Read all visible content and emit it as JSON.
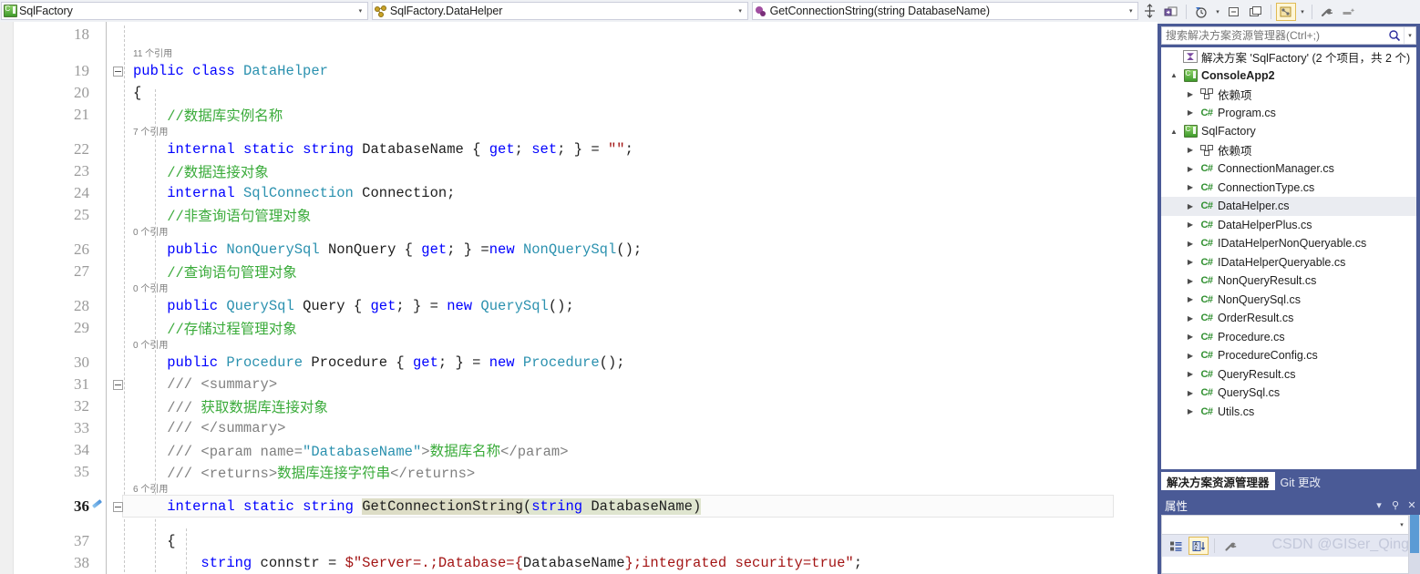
{
  "navbar": {
    "project_combo": {
      "icon": "csharp-project-icon",
      "value": "SqlFactory",
      "arrow": "▾"
    },
    "type_combo": {
      "icon": "class-icon",
      "value": "SqlFactory.DataHelper",
      "arrow": "▾"
    },
    "member_combo": {
      "icon": "method-icon",
      "value": "GetConnectionString(string DatabaseName)",
      "arrow": "▾"
    },
    "splitter_icon": "split-window-icon"
  },
  "editor": {
    "lines": [
      {
        "num": "18",
        "fold": false,
        "ref": null,
        "tokens": []
      },
      {
        "num": "19",
        "fold": true,
        "ref": "11 个引用",
        "tokens": [
          {
            "t": "public ",
            "c": "tok-kw"
          },
          {
            "t": "class ",
            "c": "tok-kw"
          },
          {
            "t": "DataHelper",
            "c": "tok-type"
          }
        ]
      },
      {
        "num": "20",
        "fold": false,
        "ref": null,
        "tokens": [
          {
            "t": "{",
            "c": "tok-plain"
          }
        ]
      },
      {
        "num": "21",
        "fold": false,
        "ref": null,
        "tokens": [
          {
            "t": "    //数据库实例名称",
            "c": "tok-cmt"
          }
        ]
      },
      {
        "num": "22",
        "fold": false,
        "ref": "7 个引用",
        "tokens": [
          {
            "t": "    ",
            "c": "tok-plain"
          },
          {
            "t": "internal ",
            "c": "tok-kw"
          },
          {
            "t": "static ",
            "c": "tok-kw"
          },
          {
            "t": "string ",
            "c": "tok-kw"
          },
          {
            "t": "DatabaseName { ",
            "c": "tok-plain"
          },
          {
            "t": "get",
            "c": "tok-kw"
          },
          {
            "t": "; ",
            "c": "tok-plain"
          },
          {
            "t": "set",
            "c": "tok-kw"
          },
          {
            "t": "; } = ",
            "c": "tok-plain"
          },
          {
            "t": "\"\"",
            "c": "tok-str"
          },
          {
            "t": ";",
            "c": "tok-plain"
          }
        ]
      },
      {
        "num": "23",
        "fold": false,
        "ref": null,
        "tokens": [
          {
            "t": "    //数据连接对象",
            "c": "tok-cmt"
          }
        ]
      },
      {
        "num": "24",
        "fold": false,
        "ref": null,
        "tokens": [
          {
            "t": "    ",
            "c": "tok-plain"
          },
          {
            "t": "internal ",
            "c": "tok-kw"
          },
          {
            "t": "SqlConnection",
            "c": "tok-type"
          },
          {
            "t": " Connection;",
            "c": "tok-plain"
          }
        ]
      },
      {
        "num": "25",
        "fold": false,
        "ref": null,
        "tokens": [
          {
            "t": "    //非查询语句管理对象",
            "c": "tok-cmt"
          }
        ]
      },
      {
        "num": "26",
        "fold": false,
        "ref": "0 个引用",
        "tokens": [
          {
            "t": "    ",
            "c": "tok-plain"
          },
          {
            "t": "public ",
            "c": "tok-kw"
          },
          {
            "t": "NonQuerySql",
            "c": "tok-type"
          },
          {
            "t": " NonQuery { ",
            "c": "tok-plain"
          },
          {
            "t": "get",
            "c": "tok-kw"
          },
          {
            "t": "; } =",
            "c": "tok-plain"
          },
          {
            "t": "new ",
            "c": "tok-kw"
          },
          {
            "t": "NonQuerySql",
            "c": "tok-type"
          },
          {
            "t": "();",
            "c": "tok-plain"
          }
        ]
      },
      {
        "num": "27",
        "fold": false,
        "ref": null,
        "tokens": [
          {
            "t": "    //查询语句管理对象",
            "c": "tok-cmt"
          }
        ]
      },
      {
        "num": "28",
        "fold": false,
        "ref": "0 个引用",
        "tokens": [
          {
            "t": "    ",
            "c": "tok-plain"
          },
          {
            "t": "public ",
            "c": "tok-kw"
          },
          {
            "t": "QuerySql",
            "c": "tok-type"
          },
          {
            "t": " Query { ",
            "c": "tok-plain"
          },
          {
            "t": "get",
            "c": "tok-kw"
          },
          {
            "t": "; } = ",
            "c": "tok-plain"
          },
          {
            "t": "new ",
            "c": "tok-kw"
          },
          {
            "t": "QuerySql",
            "c": "tok-type"
          },
          {
            "t": "();",
            "c": "tok-plain"
          }
        ]
      },
      {
        "num": "29",
        "fold": false,
        "ref": null,
        "tokens": [
          {
            "t": "    //存储过程管理对象",
            "c": "tok-cmt"
          }
        ]
      },
      {
        "num": "30",
        "fold": false,
        "ref": "0 个引用",
        "tokens": [
          {
            "t": "    ",
            "c": "tok-plain"
          },
          {
            "t": "public ",
            "c": "tok-kw"
          },
          {
            "t": "Procedure",
            "c": "tok-type"
          },
          {
            "t": " Procedure { ",
            "c": "tok-plain"
          },
          {
            "t": "get",
            "c": "tok-kw"
          },
          {
            "t": "; } = ",
            "c": "tok-plain"
          },
          {
            "t": "new ",
            "c": "tok-kw"
          },
          {
            "t": "Procedure",
            "c": "tok-type"
          },
          {
            "t": "();",
            "c": "tok-plain"
          }
        ]
      },
      {
        "num": "31",
        "fold": true,
        "ref": null,
        "tokens": [
          {
            "t": "    /// ",
            "c": "tok-cmt-x"
          },
          {
            "t": "<summary>",
            "c": "tok-xml"
          }
        ]
      },
      {
        "num": "32",
        "fold": false,
        "ref": null,
        "tokens": [
          {
            "t": "    /// ",
            "c": "tok-cmt-x"
          },
          {
            "t": "获取数据库连接对象",
            "c": "tok-xmltxt"
          }
        ]
      },
      {
        "num": "33",
        "fold": false,
        "ref": null,
        "tokens": [
          {
            "t": "    /// ",
            "c": "tok-cmt-x"
          },
          {
            "t": "</summary>",
            "c": "tok-xml"
          }
        ]
      },
      {
        "num": "34",
        "fold": false,
        "ref": null,
        "tokens": [
          {
            "t": "    /// ",
            "c": "tok-cmt-x"
          },
          {
            "t": "<param name=",
            "c": "tok-xml"
          },
          {
            "t": "\"DatabaseName\"",
            "c": "tok-type"
          },
          {
            "t": ">",
            "c": "tok-xml"
          },
          {
            "t": "数据库名称",
            "c": "tok-xmltxt"
          },
          {
            "t": "</param>",
            "c": "tok-xml"
          }
        ]
      },
      {
        "num": "35",
        "fold": false,
        "ref": null,
        "tokens": [
          {
            "t": "    /// ",
            "c": "tok-cmt-x"
          },
          {
            "t": "<returns>",
            "c": "tok-xml"
          },
          {
            "t": "数据库连接字符串",
            "c": "tok-xmltxt"
          },
          {
            "t": "</returns>",
            "c": "tok-xml"
          }
        ]
      },
      {
        "num": "36",
        "fold": true,
        "ref": "6 个引用",
        "current": true,
        "edited": true,
        "tokens": [
          {
            "t": "    ",
            "c": "tok-plain"
          },
          {
            "t": "internal ",
            "c": "tok-kw"
          },
          {
            "t": "static ",
            "c": "tok-kw"
          },
          {
            "t": "string ",
            "c": "tok-kw"
          },
          {
            "t": "GetConnectionString",
            "c": "tok-plain hl-method"
          },
          {
            "t": "(",
            "c": "tok-plain hl-param"
          },
          {
            "t": "string ",
            "c": "tok-kw hl-param"
          },
          {
            "t": "DatabaseName",
            "c": "tok-plain hl-param"
          },
          {
            "t": ")",
            "c": "tok-plain hl-param"
          }
        ]
      },
      {
        "num": "37",
        "fold": false,
        "ref": null,
        "tokens": [
          {
            "t": "    {",
            "c": "tok-plain"
          }
        ]
      },
      {
        "num": "38",
        "fold": false,
        "ref": null,
        "tokens": [
          {
            "t": "        ",
            "c": "tok-plain"
          },
          {
            "t": "string ",
            "c": "tok-kw"
          },
          {
            "t": "connstr = ",
            "c": "tok-plain"
          },
          {
            "t": "$\"Server=.;Database={",
            "c": "tok-str"
          },
          {
            "t": "DatabaseName",
            "c": "tok-plain"
          },
          {
            "t": "};integrated security=true\"",
            "c": "tok-str"
          },
          {
            "t": ";",
            "c": "tok-plain"
          }
        ]
      }
    ]
  },
  "solution_explorer": {
    "toolbar": [
      {
        "name": "go-to-window-icon",
        "label": ""
      },
      {
        "name": "pending-changes-filter-icon",
        "label": ""
      },
      {
        "name": "collapse-all-icon",
        "label": ""
      },
      {
        "name": "show-all-files-icon",
        "label": ""
      },
      {
        "name": "view-class-diagram-icon",
        "label": "",
        "active": true
      },
      {
        "name": "properties-wrench-icon",
        "label": ""
      },
      {
        "name": "preview-selected-items-icon",
        "label": ""
      }
    ],
    "search_placeholder": "搜索解决方案资源管理器(Ctrl+;)",
    "tree": [
      {
        "indent": 0,
        "expander": "",
        "icon": "solution-icon",
        "label": "解决方案 'SqlFactory' (2 个项目，共 2 个)",
        "bold": false
      },
      {
        "indent": 0,
        "expander": "▲",
        "icon": "csharp-project-icon",
        "label": "ConsoleApp2",
        "bold": true
      },
      {
        "indent": 1,
        "expander": "▶",
        "icon": "dependencies-icon",
        "label": "依赖项",
        "bold": false
      },
      {
        "indent": 1,
        "expander": "▶",
        "icon": "csharp-file-icon",
        "label": "Program.cs",
        "bold": false
      },
      {
        "indent": 0,
        "expander": "▲",
        "icon": "csharp-project-icon",
        "label": "SqlFactory",
        "bold": false
      },
      {
        "indent": 1,
        "expander": "▶",
        "icon": "dependencies-icon",
        "label": "依赖项",
        "bold": false
      },
      {
        "indent": 1,
        "expander": "▶",
        "icon": "csharp-file-icon",
        "label": "ConnectionManager.cs",
        "bold": false
      },
      {
        "indent": 1,
        "expander": "▶",
        "icon": "csharp-file-icon",
        "label": "ConnectionType.cs",
        "bold": false
      },
      {
        "indent": 1,
        "expander": "▶",
        "icon": "csharp-file-icon",
        "label": "DataHelper.cs",
        "bold": false,
        "selected": true
      },
      {
        "indent": 1,
        "expander": "▶",
        "icon": "csharp-file-icon",
        "label": "DataHelperPlus.cs",
        "bold": false
      },
      {
        "indent": 1,
        "expander": "▶",
        "icon": "csharp-file-icon",
        "label": "IDataHelperNonQueryable.cs",
        "bold": false
      },
      {
        "indent": 1,
        "expander": "▶",
        "icon": "csharp-file-icon",
        "label": "IDataHelperQueryable.cs",
        "bold": false
      },
      {
        "indent": 1,
        "expander": "▶",
        "icon": "csharp-file-icon",
        "label": "NonQueryResult.cs",
        "bold": false
      },
      {
        "indent": 1,
        "expander": "▶",
        "icon": "csharp-file-icon",
        "label": "NonQuerySql.cs",
        "bold": false
      },
      {
        "indent": 1,
        "expander": "▶",
        "icon": "csharp-file-icon",
        "label": "OrderResult.cs",
        "bold": false
      },
      {
        "indent": 1,
        "expander": "▶",
        "icon": "csharp-file-icon",
        "label": "Procedure.cs",
        "bold": false
      },
      {
        "indent": 1,
        "expander": "▶",
        "icon": "csharp-file-icon",
        "label": "ProcedureConfig.cs",
        "bold": false
      },
      {
        "indent": 1,
        "expander": "▶",
        "icon": "csharp-file-icon",
        "label": "QueryResult.cs",
        "bold": false
      },
      {
        "indent": 1,
        "expander": "▶",
        "icon": "csharp-file-icon",
        "label": "QuerySql.cs",
        "bold": false
      },
      {
        "indent": 1,
        "expander": "▶",
        "icon": "csharp-file-icon",
        "label": "Utils.cs",
        "bold": false
      }
    ],
    "tabs": [
      {
        "label": "解决方案资源管理器",
        "active": true
      },
      {
        "label": "Git 更改",
        "active": false
      }
    ]
  },
  "properties_panel": {
    "title": "属性",
    "dropdown_caret": "▾",
    "pin_icon": "pin-icon",
    "close_icon": "close-icon",
    "toolbar": [
      {
        "name": "categorized-icon",
        "active": false
      },
      {
        "name": "alphabetical-sort-icon",
        "active": true
      },
      {
        "name": "property-pages-icon",
        "active": false
      }
    ],
    "combo_value": ""
  },
  "watermark": "CSDN @GISer_Qing",
  "colors": {
    "accent_dock": "#4a5a96",
    "keyword": "#0000ff",
    "type": "#2b91af",
    "comment": "#3aab3a",
    "string": "#a31515",
    "selection_highlight": "#ddddc6"
  }
}
